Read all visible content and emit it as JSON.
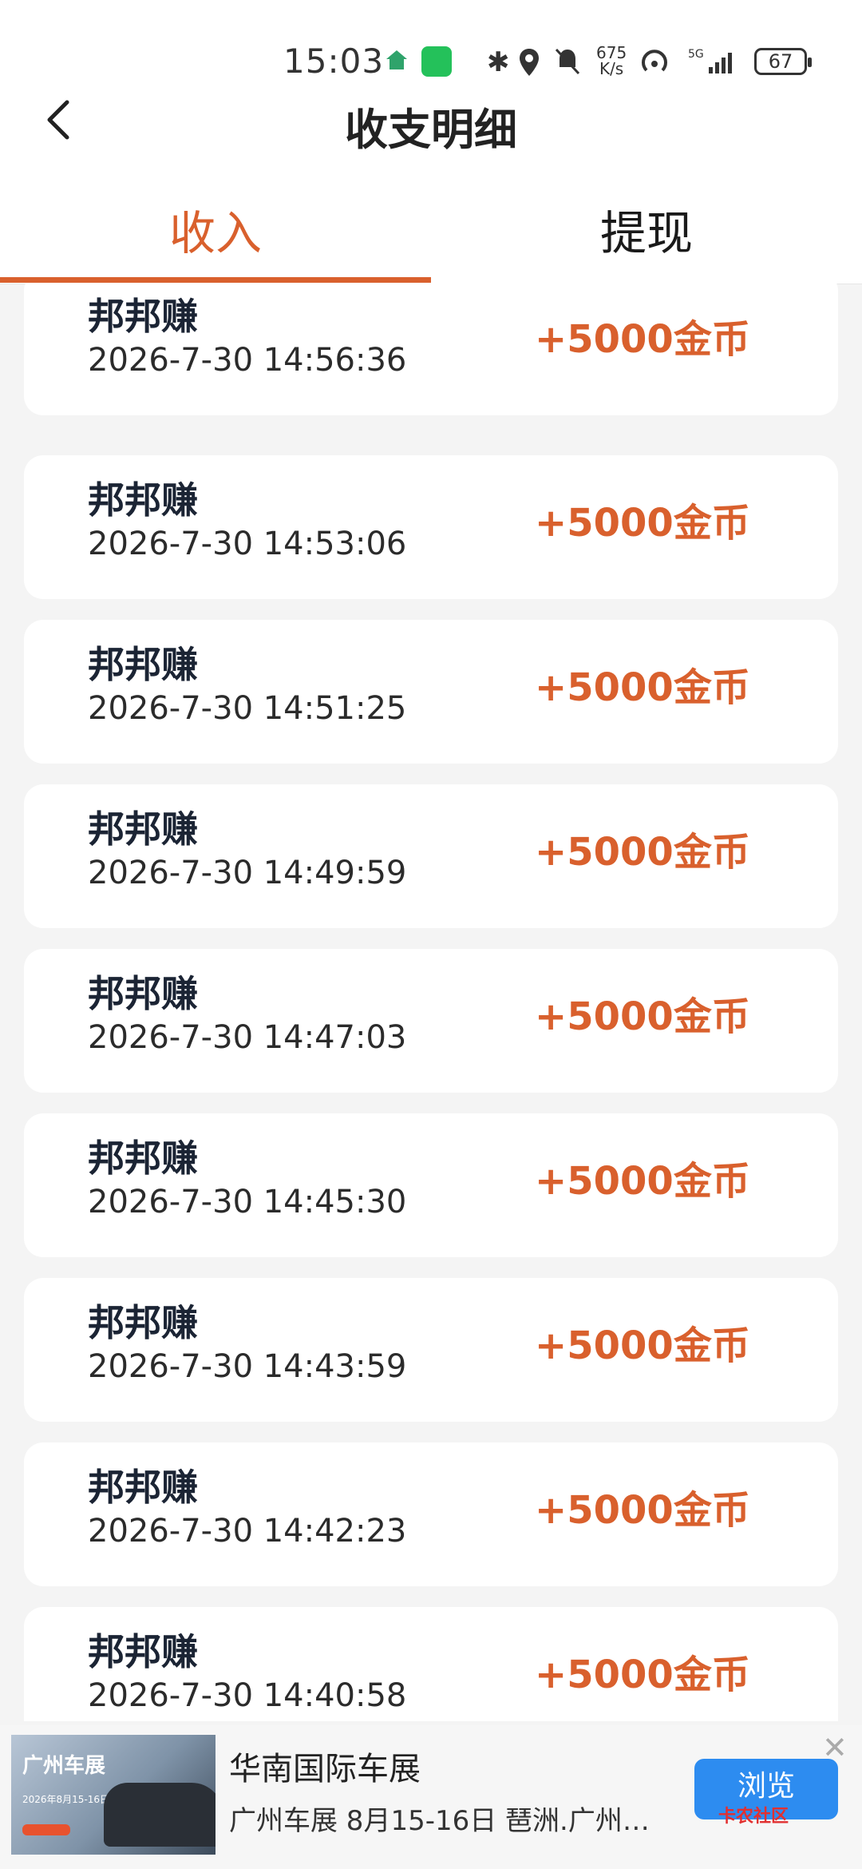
{
  "status_bar": {
    "time": "15:03",
    "net_speed_top": "675",
    "net_speed_bottom": "K/s",
    "battery": "67"
  },
  "header": {
    "title": "收支明细",
    "tabs": [
      {
        "label": "收入",
        "active": true
      },
      {
        "label": "提现",
        "active": false
      }
    ]
  },
  "records": [
    {
      "name": "邦邦赚",
      "time": "2026-7-30 14:56:36",
      "amount": "+5000金币"
    },
    {
      "name": "邦邦赚",
      "time": "2026-7-30 14:53:06",
      "amount": "+5000金币"
    },
    {
      "name": "邦邦赚",
      "time": "2026-7-30 14:51:25",
      "amount": "+5000金币"
    },
    {
      "name": "邦邦赚",
      "time": "2026-7-30 14:49:59",
      "amount": "+5000金币"
    },
    {
      "name": "邦邦赚",
      "time": "2026-7-30 14:47:03",
      "amount": "+5000金币"
    },
    {
      "name": "邦邦赚",
      "time": "2026-7-30 14:45:30",
      "amount": "+5000金币"
    },
    {
      "name": "邦邦赚",
      "time": "2026-7-30 14:43:59",
      "amount": "+5000金币"
    },
    {
      "name": "邦邦赚",
      "time": "2026-7-30 14:42:23",
      "amount": "+5000金币"
    },
    {
      "name": "邦邦赚",
      "time": "2026-7-30 14:40:58",
      "amount": "+5000金币"
    }
  ],
  "ad": {
    "image_title": "广州车展",
    "image_small": "2026年8月15-16日",
    "title": "华南国际车展",
    "subtitle": "广州车展 8月15-16日 琶洲.广州…",
    "button": "浏览",
    "watermark": "卡农社区"
  },
  "colors": {
    "accent": "#d9602d",
    "ad_button": "#2d8cf0"
  }
}
